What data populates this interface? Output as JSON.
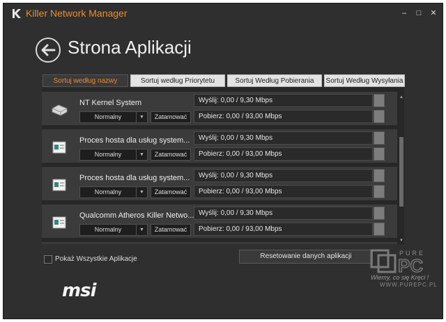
{
  "window": {
    "title": "Killer Network Manager",
    "controls": {
      "minimize": "–",
      "maximize": "□",
      "close": "✕"
    }
  },
  "header": {
    "title": "Strona Aplikacji"
  },
  "sort_tabs": [
    {
      "label": "Sortuj według nazwy",
      "active": true
    },
    {
      "label": "Sortuj według Priorytetu",
      "active": false
    },
    {
      "label": "Sortuj Według Pobierania",
      "active": false
    },
    {
      "label": "Sortuj Według Wysyłania",
      "active": false
    }
  ],
  "apps": [
    {
      "name": "NT Kernel  System",
      "icon": "system-drive-icon",
      "priority": "Normalny",
      "lock_label": "Zatamować",
      "upload": "Wyślij: 0,00 / 9,30 Mbps",
      "download": "Pobierz: 0,00 / 93,00 Mbps"
    },
    {
      "name": "Proces hosta dla usług system...",
      "icon": "app-window-icon",
      "priority": "Normalny",
      "lock_label": "Zatamować",
      "upload": "Wyślij: 0,00 / 9,30 Mbps",
      "download": "Pobierz: 0,00 / 93,00 Mbps"
    },
    {
      "name": "Proces hosta dla usług system...",
      "icon": "app-window-icon",
      "priority": "Normalny",
      "lock_label": "Zatamować",
      "upload": "Wyślij: 0,00 / 9,30 Mbps",
      "download": "Pobierz: 0,00 / 93,00 Mbps"
    },
    {
      "name": "Qualcomm Atheros Killer Netwo...",
      "icon": "app-window-icon",
      "priority": "Normalny",
      "lock_label": "Zatamować",
      "upload": "Wyślij: 0,00 / 9,30 Mbps",
      "download": "Pobierz: 0,00 / 93,00 Mbps"
    }
  ],
  "footer": {
    "show_all_label": "Pokaż Wszystkie Aplikacje",
    "show_all_checked": false,
    "reset_label": "Resetowanie danych aplikacji"
  },
  "brand": {
    "logo_text": "msi"
  },
  "watermark": {
    "pure": "PURE",
    "pc": "PC",
    "tagline": "Wiemy, co się Kręci !",
    "url": "WWW.PUREPC.PL"
  },
  "colors": {
    "accent": "#f08a2a",
    "background": "#2f2f2f",
    "row": "#3b3b3b"
  }
}
